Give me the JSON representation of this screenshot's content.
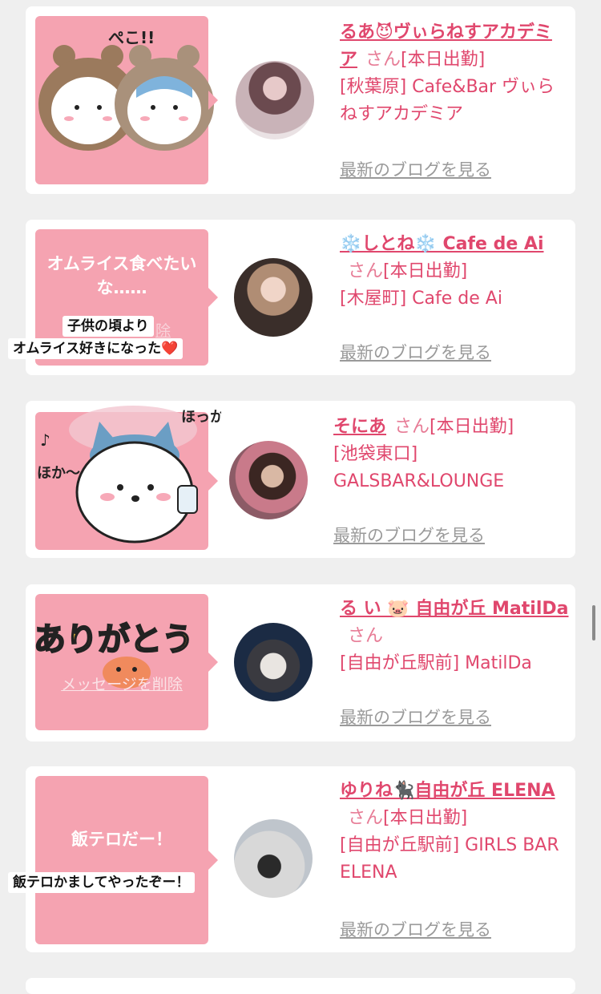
{
  "entries": [
    {
      "cast_name": "るあ😈ヴぃらねすアカデミア",
      "honorific": "さん",
      "status": "[本日出勤]",
      "store": "[秋葉原] Cafe&Bar ヴぃらねすアカデミア",
      "blog_link": "最新のブログを見る",
      "sticker_text": "ぺこ!!"
    },
    {
      "cast_name": "❄️しとね❄️ Cafe de Ai",
      "honorific": "さん",
      "status": "[本日出勤]",
      "store": "[木屋町] Cafe de Ai",
      "blog_link": "最新のブログを見る",
      "bubble_text": "オムライス食べたいな……",
      "caption_line1": "子供の頃より",
      "caption_line2": "オムライス好きになった❤️",
      "bubble_partial": "除"
    },
    {
      "cast_name": "そにあ",
      "honorific": "さん",
      "status": "[本日出勤]",
      "store": "[池袋東口] GALSBAR&LOUNGE",
      "blog_link": "最新のブログを見る",
      "sticker_text_1": "ほっか",
      "sticker_text_2": "ほか〜",
      "note": "♪"
    },
    {
      "cast_name": "る い 🐷 自由が丘 MatilDa",
      "honorific": "さん",
      "status": "",
      "store": "[自由が丘駅前] MatilDa",
      "blog_link": "最新のブログを見る",
      "sticker_text": "ありがとう",
      "delete_link": "メッセージを削除"
    },
    {
      "cast_name": "ゆりね🐈‍⬛自由が丘 ELENA",
      "honorific": "さん",
      "status": "[本日出勤]",
      "store": "[自由が丘駅前] GIRLS BAR ELENA",
      "blog_link": "最新のブログを見る",
      "bubble_text": "飯テロだー！",
      "caption_line1": "飯テロかましてやったぞー！"
    }
  ],
  "colors": {
    "accent": "#e0476d",
    "bubble": "#f5a3b1",
    "link_gray": "#9a9a9a"
  }
}
